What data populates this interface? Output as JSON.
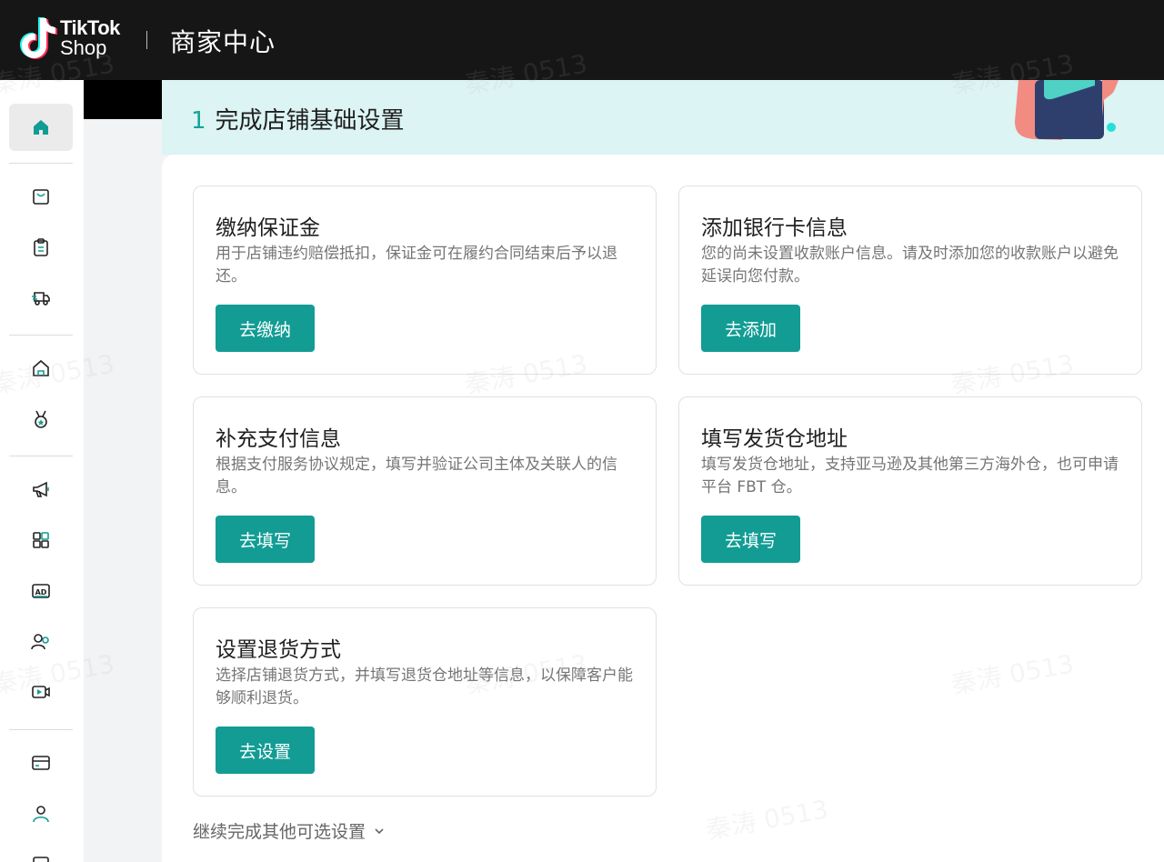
{
  "header": {
    "brand_line1": "TikTok",
    "brand_line2": "Shop",
    "app_title": "商家中心"
  },
  "sidebar": {
    "items": [
      {
        "icon": "home-icon",
        "active": true
      },
      {
        "icon": "shopping-bag-icon"
      },
      {
        "icon": "clipboard-icon"
      },
      {
        "icon": "delivery-truck-icon"
      },
      {
        "icon": "store-icon"
      },
      {
        "icon": "medal-icon"
      },
      {
        "icon": "megaphone-icon"
      },
      {
        "icon": "apps-grid-icon"
      },
      {
        "icon": "ad-icon"
      },
      {
        "icon": "users-icon"
      },
      {
        "icon": "video-icon"
      },
      {
        "icon": "wallet-icon"
      },
      {
        "icon": "person-icon"
      }
    ]
  },
  "banner": {
    "step_number": "1",
    "title": "完成店铺基础设置"
  },
  "cards": [
    {
      "title": "缴纳保证金",
      "desc": "用于店铺违约赔偿抵扣，保证金可在履约合同结束后予以退还。",
      "button": "去缴纳"
    },
    {
      "title": "添加银行卡信息",
      "desc": "您的尚未设置收款账户信息。请及时添加您的收款账户以避免延误向您付款。",
      "button": "去添加"
    },
    {
      "title": "补充支付信息",
      "desc": "根据支付服务协议规定，填写并验证公司主体及关联人的信息。",
      "button": "去填写"
    },
    {
      "title": "填写发货仓地址",
      "desc": "填写发货仓地址，支持亚马逊及其他第三方海外仓，也可申请平台 FBT 仓。",
      "button": "去填写"
    },
    {
      "title": "设置退货方式",
      "desc": "选择店铺退货方式，并填写退货仓地址等信息，以保障客户能够顺利退货。",
      "button": "去设置"
    }
  ],
  "more_link": "继续完成其他可选设置",
  "watermark": "秦涛 0513",
  "colors": {
    "accent": "#129c94",
    "banner_bg": "#dcf4f3",
    "topbar_bg": "#161616"
  }
}
